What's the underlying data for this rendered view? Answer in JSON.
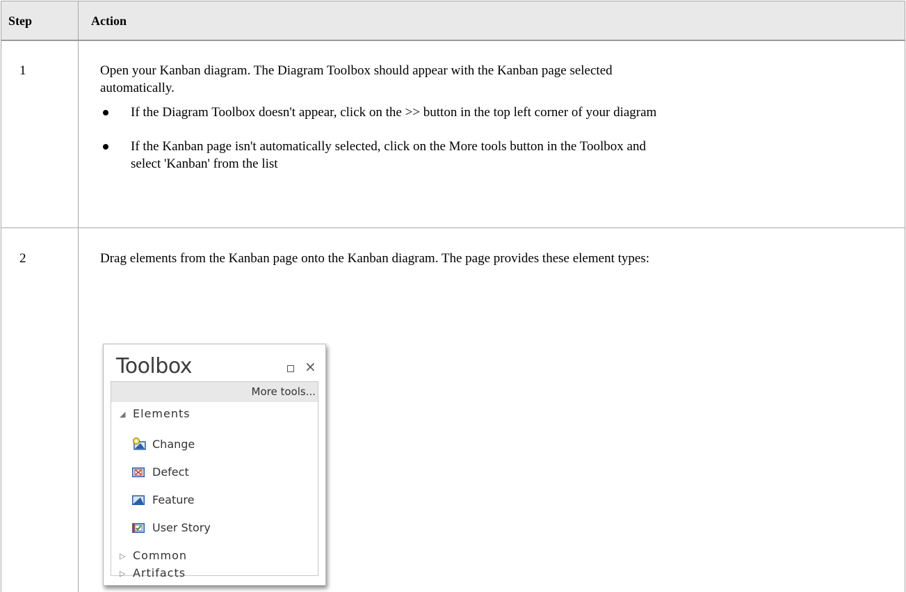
{
  "table": {
    "header": {
      "step": "Step",
      "action": "Action"
    },
    "rows": [
      {
        "step": "1",
        "text_line1": "Open your Kanban diagram. The Diagram Toolbox should appear with the Kanban page selected",
        "text_line2": "automatically.",
        "bullets": [
          {
            "line1": "If the Diagram Toolbox doesn't appear, click on the >> button in the top left corner of your diagram",
            "line2": ""
          },
          {
            "line1": "If the Kanban page isn't automatically selected, click on the More tools button in the Toolbox and",
            "line2": "select 'Kanban' from the list"
          }
        ]
      },
      {
        "step": "2",
        "text_line1": "Drag elements from the Kanban page onto the Kanban diagram. The page provides these element types:"
      }
    ]
  },
  "toolbox": {
    "title": "Toolbox",
    "restore_icon": "restore-window-icon",
    "close_glyph": "×",
    "more_tools": "More tools...",
    "sections": {
      "elements": {
        "label": "Elements",
        "expanded_glyph": "◢",
        "items": [
          {
            "label": "Change",
            "icon": "change-icon"
          },
          {
            "label": "Defect",
            "icon": "defect-icon"
          },
          {
            "label": "Feature",
            "icon": "feature-icon"
          },
          {
            "label": "User Story",
            "icon": "user-story-icon"
          }
        ]
      },
      "common": {
        "label": "Common",
        "collapsed_glyph": "▷"
      },
      "artifacts": {
        "label": "Artifacts",
        "collapsed_glyph": "▷"
      }
    },
    "colors": {
      "icon_blue": "#2a5fa8",
      "defect_red": "#c0392b",
      "story_green": "#2e8b2e",
      "change_star": "#e8c21a"
    }
  }
}
